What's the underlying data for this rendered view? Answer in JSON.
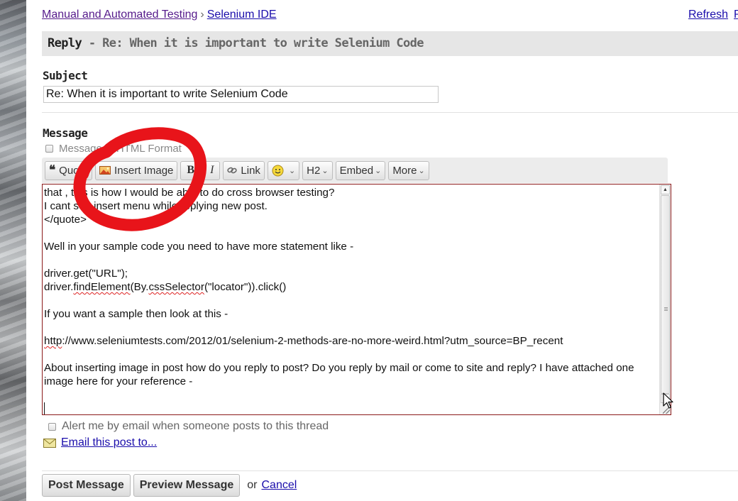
{
  "breadcrumb": {
    "items": [
      "Manual and Automated Testing",
      "Selenium IDE"
    ],
    "separator": "›"
  },
  "top_right": {
    "refresh": "Refresh",
    "next": "P"
  },
  "reply_bar": {
    "prefix": "Reply",
    "title": " - Re: When it is important to write Selenium Code"
  },
  "subject": {
    "label": "Subject",
    "value": "Re: When it is important to write Selenium Code"
  },
  "message": {
    "label": "Message",
    "html_toggle_label": "Message in HTML Format"
  },
  "toolbar": {
    "quote": "Quote",
    "insert_image": "Insert Image",
    "bold": "B",
    "italic": "I",
    "link": "Link",
    "h2": "H2",
    "embed": "Embed",
    "more": "More"
  },
  "editor": {
    "line1": "that , this is how I would be able to do cross browser testing?",
    "line2": "I cant see insert menu while replying new post.",
    "line3": "</quote>",
    "line4": "Well in your sample code you need to have more statement like -",
    "line5": "driver.get(\"URL\");",
    "line6_prefix": "driver.",
    "line6_squig1": "findElement",
    "line6_mid": "(By.",
    "line6_squig2": "cssSelector",
    "line6_suffix": "(\"locator\")).click()",
    "line7": "If you want a sample then look at this -",
    "line8_squig": "http",
    "line8_rest": "://www.seleniumtests.com/2012/01/selenium-2-methods-are-no-more-weird.html?utm_source=BP_recent",
    "line9": "About inserting image in post how do you reply to post? Do you reply by mail or come to site and reply? I have attached one image here for your reference -"
  },
  "alert_label": "Alert me by email when someone posts to this thread",
  "email_link": "Email this post to...",
  "actions": {
    "post": "Post Message",
    "preview": "Preview Message",
    "or": "or",
    "cancel": "Cancel"
  },
  "colors": {
    "link": "#1a0dab",
    "visited_link": "#551a8b",
    "annotation": "#e8141a",
    "editor_border": "#8b1a1a"
  },
  "icons": [
    "quote-icon",
    "image-icon",
    "link-icon",
    "smiley-icon",
    "envelope-icon",
    "mouse-cursor-icon"
  ]
}
